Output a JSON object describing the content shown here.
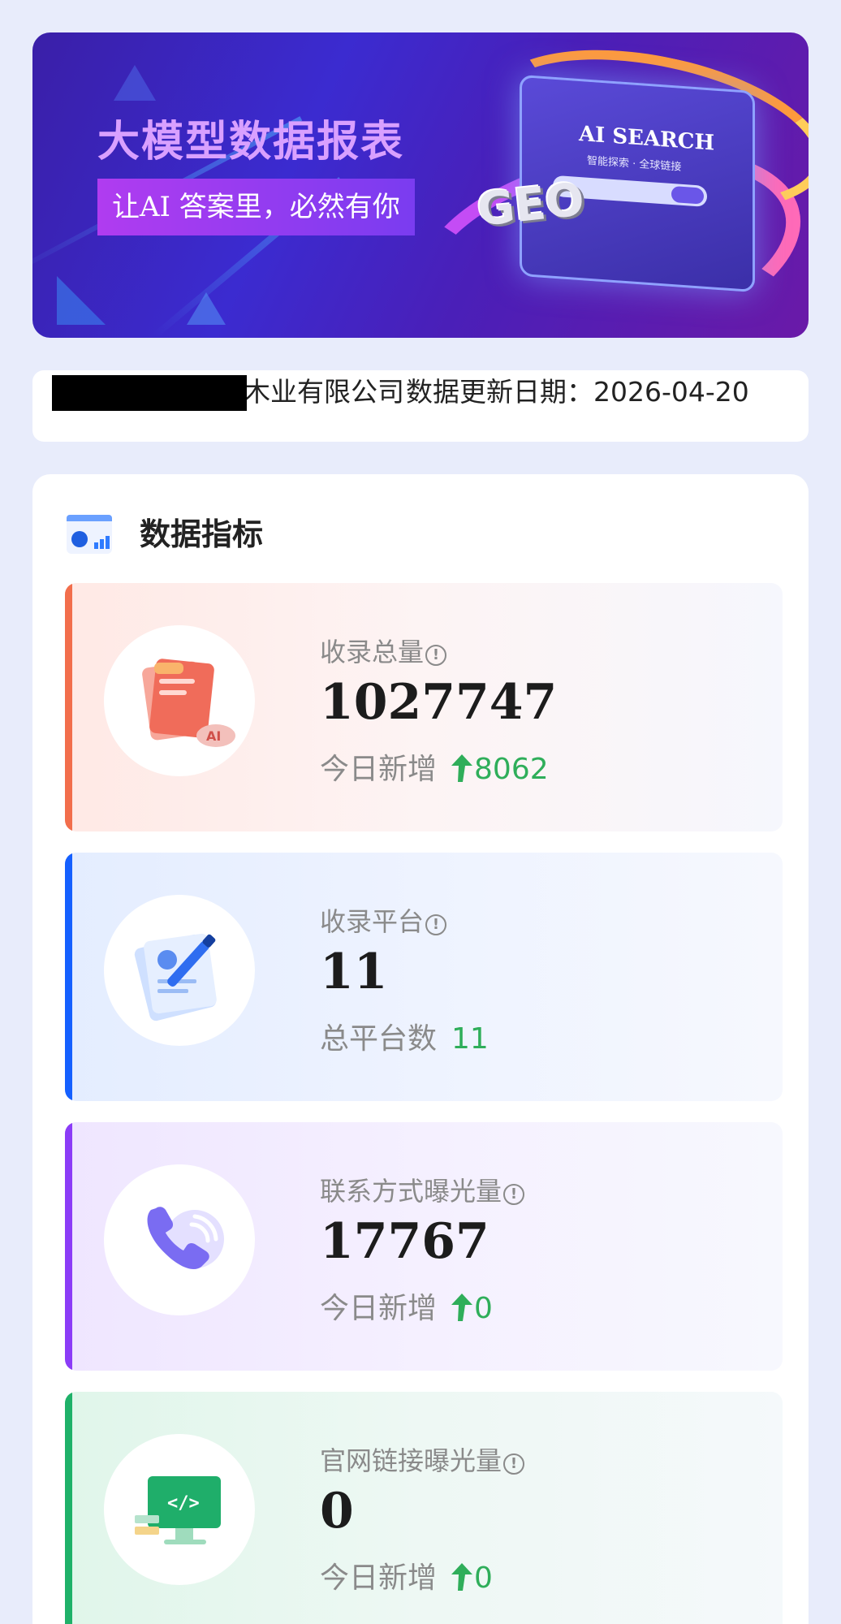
{
  "banner": {
    "title": "大模型数据报表",
    "tagline": "让AI 答案里，必然有你",
    "screen_title": "AI SEARCH",
    "screen_subtitle": "智能探索 · 全球链接",
    "badge": "GEO"
  },
  "company": {
    "name": "木业有限公司",
    "update_label": "数据更新日期：2026-04-20"
  },
  "panel": {
    "title": "数据指标"
  },
  "metrics": [
    {
      "label": "收录总量",
      "value": "1027747",
      "sub_label": "今日新增",
      "delta": "8062",
      "has_arrow": true
    },
    {
      "label": "收录平台",
      "value": "11",
      "sub_label": "总平台数",
      "delta": "11",
      "has_arrow": false
    },
    {
      "label": "联系方式曝光量",
      "value": "17767",
      "sub_label": "今日新增",
      "delta": "0",
      "has_arrow": true
    },
    {
      "label": "官网链接曝光量",
      "value": "0",
      "sub_label": "今日新增",
      "delta": "0",
      "has_arrow": true
    }
  ],
  "info_glyph": "!",
  "colors": {
    "page_bg": "#e8ecfb",
    "accent_orange": "#f26e4c",
    "accent_blue": "#1560ff",
    "accent_purple": "#8b3cf7",
    "accent_green": "#1fb169",
    "delta_green": "#2fae5a"
  },
  "icons": [
    "document-ai-icon",
    "notebook-pen-icon",
    "phone-call-icon",
    "monitor-code-icon",
    "data-chart-icon",
    "info-icon",
    "arrow-up-icon"
  ]
}
